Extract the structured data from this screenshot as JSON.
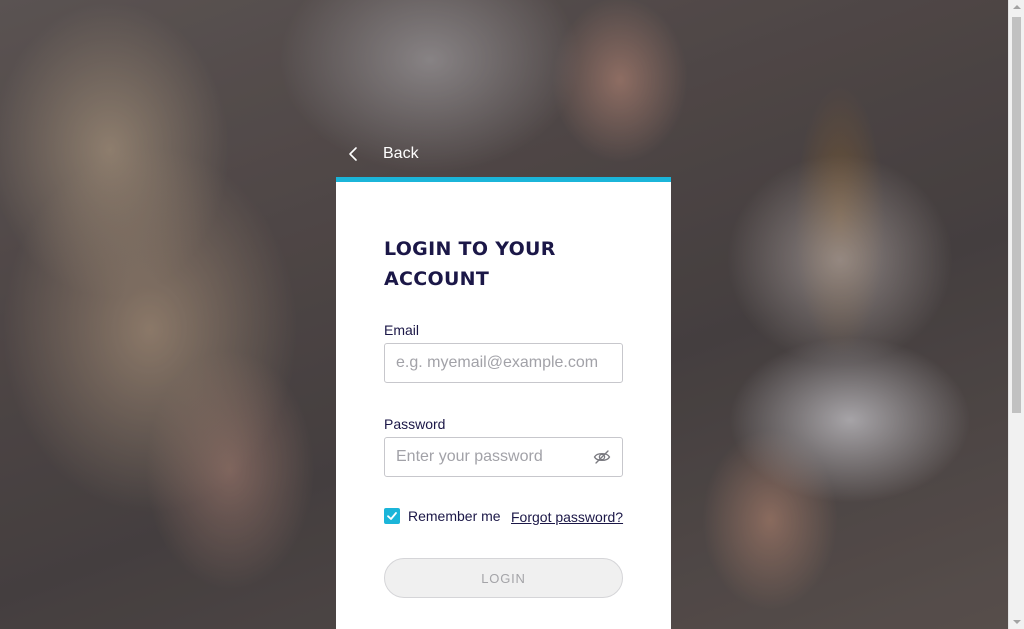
{
  "back": {
    "label": "Back",
    "icon": "chevron-left-icon"
  },
  "login_card": {
    "title": "LOGIN TO YOUR ACCOUNT",
    "accent_color": "#1bb5d9",
    "email": {
      "label": "Email",
      "value": "",
      "placeholder": "e.g. myemail@example.com"
    },
    "password": {
      "label": "Password",
      "value": "",
      "placeholder": "Enter your password",
      "toggle_icon": "eye-slash-icon"
    },
    "remember_me": {
      "label": "Remember me",
      "checked": true
    },
    "forgot_password": {
      "label": "Forgot password?"
    },
    "login_button": {
      "label": "LOGIN"
    }
  }
}
